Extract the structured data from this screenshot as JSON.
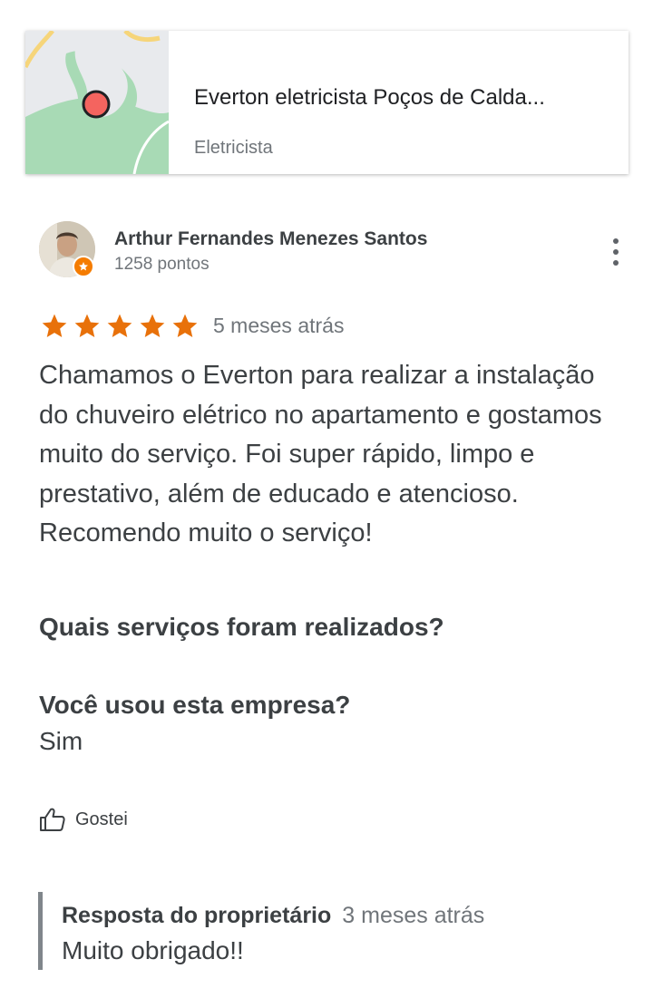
{
  "place": {
    "name": "Everton eletricista Poços de Calda...",
    "category": "Eletricista"
  },
  "review": {
    "author_name": "Arthur Fernandes Menezes Santos",
    "author_points": "1258 pontos",
    "rating": 5,
    "time": "5 meses atrás",
    "text": "Chamamos o Everton para realizar a instalação do chuveiro elétrico no apartamento e gostamos muito do serviço. Foi super rápido, limpo e prestativo, além de educado e atencioso. Recomendo muito o serviço!",
    "question_services": "Quais serviços foram realizados?",
    "question_used": "Você usou esta empresa?",
    "answer_used": "Sim",
    "like_label": "Gostei"
  },
  "owner_response": {
    "label": "Resposta do proprietário",
    "time": "3 meses atrás",
    "text": "Muito obrigado!!"
  },
  "icons": {
    "star": "star-icon",
    "more": "more-vert-icon",
    "like": "thumb-up-icon",
    "pin": "map-pin-icon"
  },
  "colors": {
    "star": "#e8710a",
    "pin": "#ea4335",
    "badge": "#f57c00",
    "map_green": "#a8dab5"
  }
}
